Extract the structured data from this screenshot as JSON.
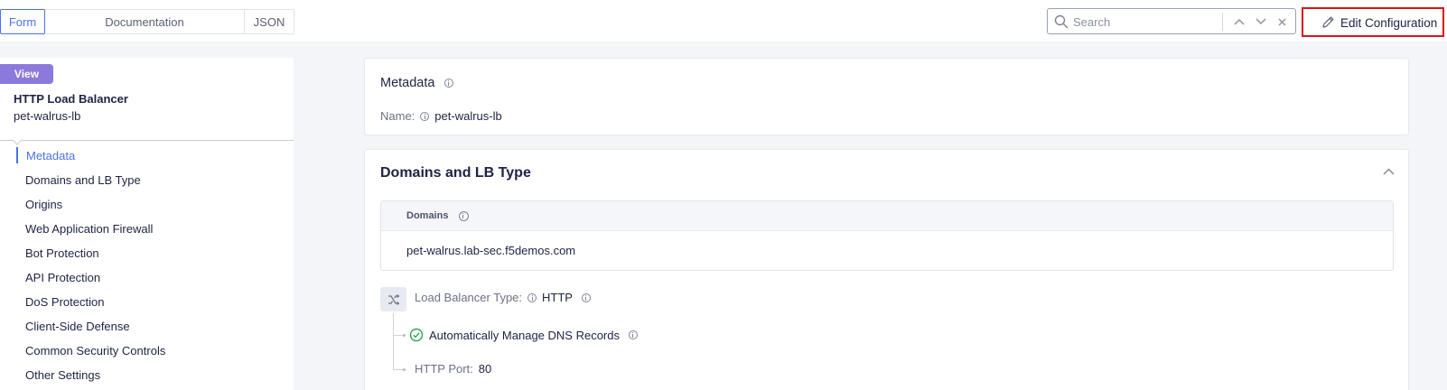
{
  "tabs": {
    "form": "Form",
    "documentation": "Documentation",
    "json": "JSON"
  },
  "search": {
    "placeholder": "Search"
  },
  "edit_button": {
    "label": "Edit Configuration"
  },
  "sidebar": {
    "badge": "View",
    "title": "HTTP Load Balancer",
    "subtitle": "pet-walrus-lb",
    "items": [
      {
        "label": "Metadata",
        "active": true
      },
      {
        "label": "Domains and LB Type"
      },
      {
        "label": "Origins"
      },
      {
        "label": "Web Application Firewall"
      },
      {
        "label": "Bot Protection"
      },
      {
        "label": "API Protection"
      },
      {
        "label": "DoS Protection"
      },
      {
        "label": "Client-Side Defense"
      },
      {
        "label": "Common Security Controls"
      },
      {
        "label": "Other Settings"
      }
    ]
  },
  "metadata": {
    "heading": "Metadata",
    "name_label": "Name:",
    "name_value": "pet-walrus-lb"
  },
  "domains_section": {
    "heading": "Domains and LB Type",
    "domains_header": "Domains",
    "domains_value": "pet-walrus.lab-sec.f5demos.com",
    "lb_type_label": "Load Balancer Type:",
    "lb_type_value": "HTTP",
    "dns_label": "Automatically Manage DNS Records",
    "port_label": "HTTP Port:",
    "port_value": "80"
  },
  "colors": {
    "accent": "#4a72e8",
    "badge": "#8c79dc",
    "highlight_border": "#d8141c",
    "success": "#2ea44f"
  }
}
